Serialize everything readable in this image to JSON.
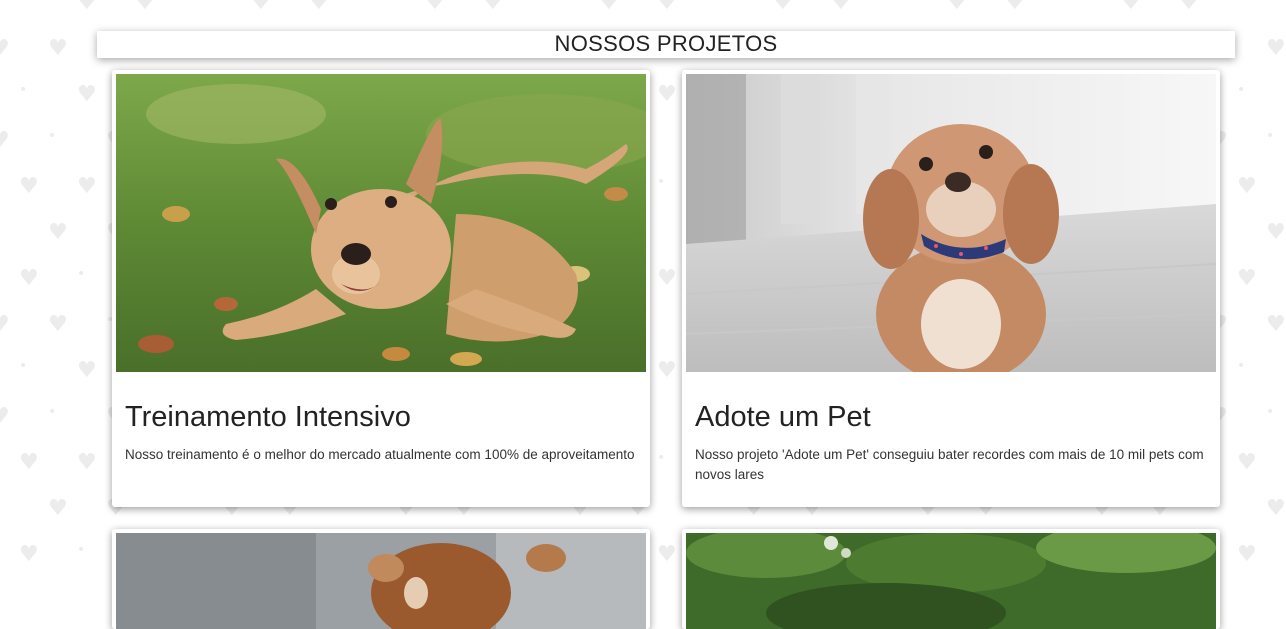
{
  "header": {
    "title": "NOSSOS PROJETOS"
  },
  "cards": [
    {
      "title": "Treinamento Intensivo",
      "description": "Nosso treinamento é o melhor do mercado atualmente com 100% de aproveitamento",
      "image_icon": "dog-playing-on-grass-photo"
    },
    {
      "title": "Adote um Pet",
      "description": "Nosso projeto 'Adote um Pet' conseguiu bater recordes com mais de 10 mil pets com novos lares",
      "image_icon": "fluffy-dog-sitting-photo"
    },
    {
      "image_icon": "small-dog-photo"
    },
    {
      "image_icon": "garden-greenery-photo"
    }
  ],
  "colors": {
    "background": "#ffffff",
    "pattern": "#ececec",
    "card": "#ffffff",
    "text": "#222222"
  }
}
